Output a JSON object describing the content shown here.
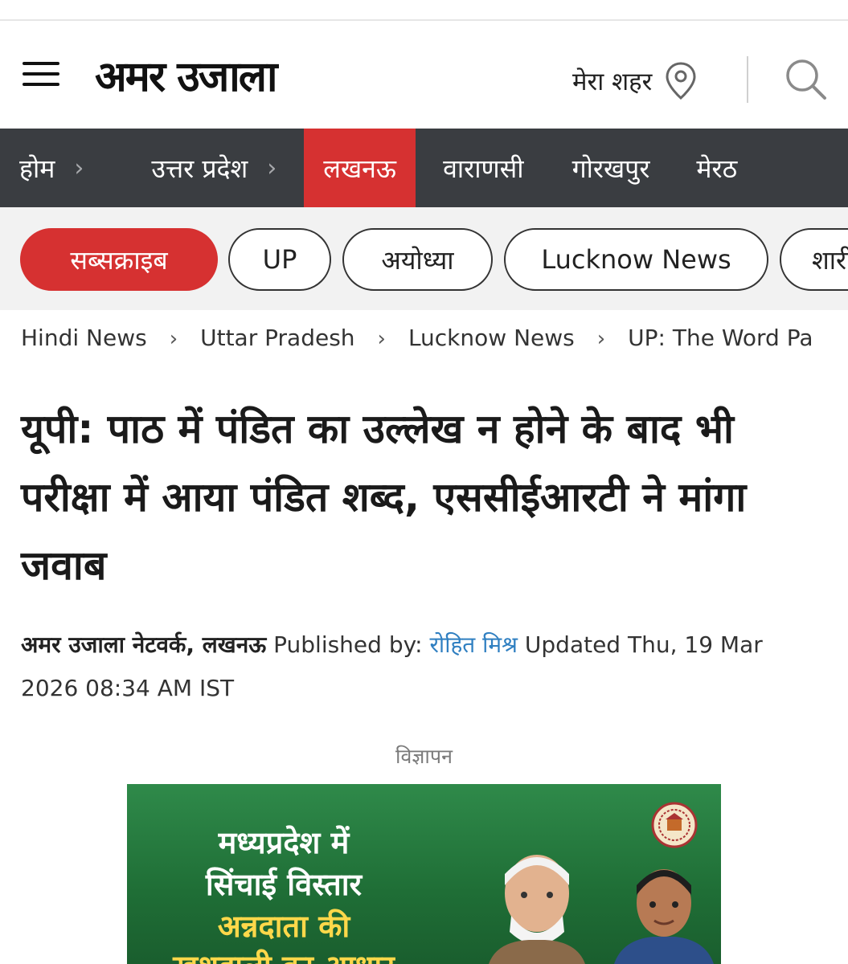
{
  "header": {
    "logo_text": "अमर उजाला",
    "city_label": "मेरा शहर"
  },
  "nav": {
    "items": [
      {
        "label": "होम"
      },
      {
        "label": "उत्तर प्रदेश"
      },
      {
        "label": "लखनऊ"
      },
      {
        "label": "वाराणसी"
      },
      {
        "label": "गोरखपुर"
      },
      {
        "label": "मेरठ"
      }
    ]
  },
  "pills": {
    "items": [
      {
        "label": "सब्सक्राइब"
      },
      {
        "label": "UP"
      },
      {
        "label": "अयोध्या"
      },
      {
        "label": "Lucknow News"
      },
      {
        "label": "शारी"
      }
    ]
  },
  "breadcrumb": {
    "items": [
      "Hindi News",
      "Uttar Pradesh",
      "Lucknow News",
      "UP: The Word Pa"
    ],
    "separator": "›"
  },
  "article": {
    "headline": "यूपी: पाठ में पंडित का उल्लेख न होने के बाद भी परीक्षा में आया पंडित शब्द, एससीईआरटी ने मांगा जवाब",
    "byline": {
      "network": "अमर उजाला नेटवर्क, लखनऊ",
      "published_prefix": "Published by:",
      "author": "रोहित मिश्र",
      "updated": "Updated Thu, 19 Mar 2026 08:34 AM IST"
    }
  },
  "ad": {
    "label": "विज्ञापन",
    "lines": [
      "मध्यप्रदेश में",
      "सिंचाई विस्तार",
      "अन्नदाता की",
      "खुशहाली का आधार"
    ]
  },
  "colors": {
    "accent_red": "#d63131",
    "nav_bg": "#3a3d41",
    "link_blue": "#2f7fc1",
    "ad_green": "#2f8a4a"
  },
  "icons": [
    "menu-icon",
    "location-pin-icon",
    "search-icon",
    "chevron-right-icon"
  ]
}
